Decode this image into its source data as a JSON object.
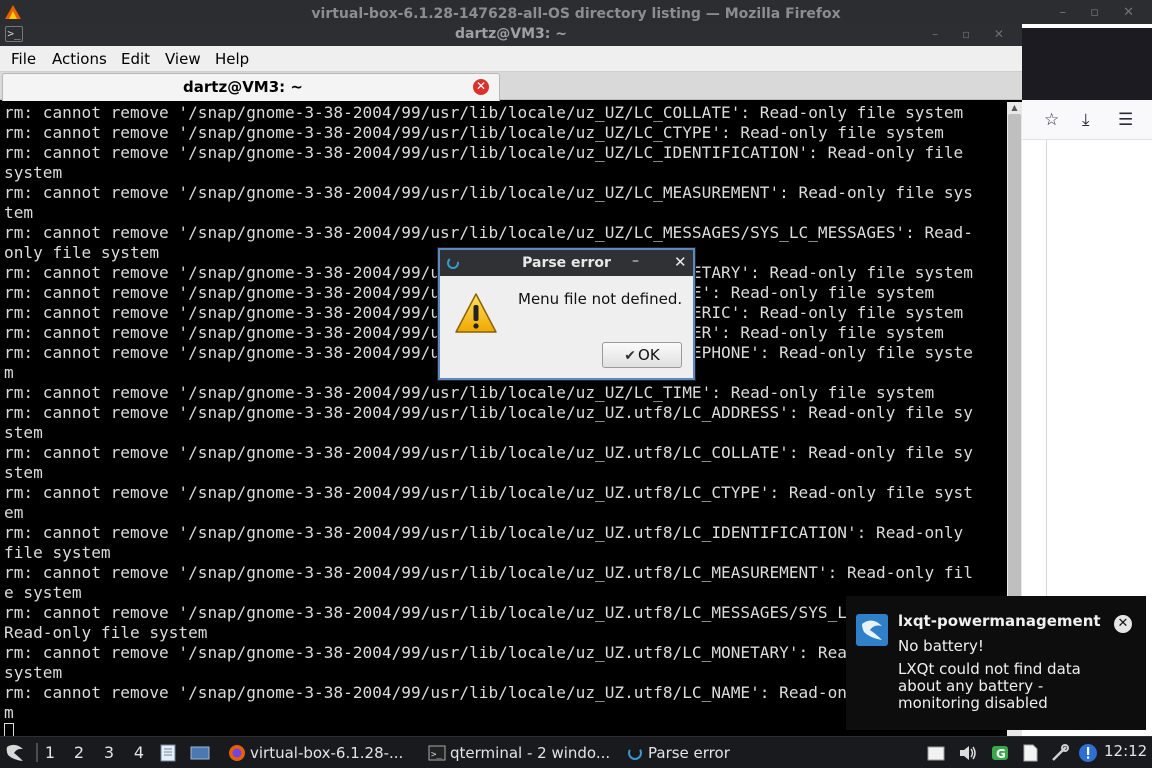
{
  "firefox": {
    "title": "virtual-box-6.1.28-147628-all-OS directory listing — Mozilla Firefox",
    "win_buttons": "– ▫ ✕"
  },
  "terminal": {
    "title": "dartz@VM3: ~",
    "win_buttons": "– ▫ ✕",
    "menu": [
      "File",
      "Actions",
      "Edit",
      "View",
      "Help"
    ],
    "tab_label": "dartz@VM3: ~",
    "lines": [
      "rm: cannot remove '/snap/gnome-3-38-2004/99/usr/lib/locale/uz_UZ/LC_COLLATE': Read-only file system",
      "rm: cannot remove '/snap/gnome-3-38-2004/99/usr/lib/locale/uz_UZ/LC_CTYPE': Read-only file system",
      "rm: cannot remove '/snap/gnome-3-38-2004/99/usr/lib/locale/uz_UZ/LC_IDENTIFICATION': Read-only file",
      "system",
      "rm: cannot remove '/snap/gnome-3-38-2004/99/usr/lib/locale/uz_UZ/LC_MEASUREMENT': Read-only file sys",
      "tem",
      "rm: cannot remove '/snap/gnome-3-38-2004/99/usr/lib/locale/uz_UZ/LC_MESSAGES/SYS_LC_MESSAGES': Read-",
      "only file system",
      "rm: cannot remove '/snap/gnome-3-38-2004/99/usr/lib/locale/uz_UZ/LC_MONETARY': Read-only file system",
      "rm: cannot remove '/snap/gnome-3-38-2004/99/usr/lib/locale/uz_UZ/LC_NAME': Read-only file system",
      "rm: cannot remove '/snap/gnome-3-38-2004/99/usr/lib/locale/uz_UZ/LC_NUMERIC': Read-only file system",
      "rm: cannot remove '/snap/gnome-3-38-2004/99/usr/lib/locale/uz_UZ/LC_PAPER': Read-only file system",
      "rm: cannot remove '/snap/gnome-3-38-2004/99/usr/lib/locale/uz_UZ/LC_TELEPHONE': Read-only file syste",
      "m",
      "rm: cannot remove '/snap/gnome-3-38-2004/99/usr/lib/locale/uz_UZ/LC_TIME': Read-only file system",
      "rm: cannot remove '/snap/gnome-3-38-2004/99/usr/lib/locale/uz_UZ.utf8/LC_ADDRESS': Read-only file sy",
      "stem",
      "rm: cannot remove '/snap/gnome-3-38-2004/99/usr/lib/locale/uz_UZ.utf8/LC_COLLATE': Read-only file sy",
      "stem",
      "rm: cannot remove '/snap/gnome-3-38-2004/99/usr/lib/locale/uz_UZ.utf8/LC_CTYPE': Read-only file syst",
      "em",
      "rm: cannot remove '/snap/gnome-3-38-2004/99/usr/lib/locale/uz_UZ.utf8/LC_IDENTIFICATION': Read-only",
      "file system",
      "rm: cannot remove '/snap/gnome-3-38-2004/99/usr/lib/locale/uz_UZ.utf8/LC_MEASUREMENT': Read-only fil",
      "e system",
      "rm: cannot remove '/snap/gnome-3-38-2004/99/usr/lib/locale/uz_UZ.utf8/LC_MESSAGES/SYS_LC_MESSAGES':",
      "Read-only file system",
      "rm: cannot remove '/snap/gnome-3-38-2004/99/usr/lib/locale/uz_UZ.utf8/LC_MONETARY': Read-only file",
      "system",
      "rm: cannot remove '/snap/gnome-3-38-2004/99/usr/lib/locale/uz_UZ.utf8/LC_NAME': Read-only file syste",
      "m"
    ]
  },
  "dialog": {
    "title": "Parse error",
    "minimize": "–",
    "close": "✕",
    "message": "Menu file not defined.",
    "ok_label": "OK"
  },
  "notification": {
    "app": "lxqt-powermanagement",
    "summary": "No battery!",
    "body": "LXQt could not find data about any battery - monitoring disabled",
    "close": "✕"
  },
  "taskbar": {
    "desktops": [
      "1",
      "2",
      "3",
      "4"
    ],
    "tasks": [
      {
        "label": "virtual-box-6.1.28-...",
        "icon": "firefox-icon"
      },
      {
        "label": "qterminal - 2 windo...",
        "icon": "terminal-icon"
      },
      {
        "label": "Parse error",
        "icon": "dialog-icon"
      }
    ],
    "clock": "12:12"
  },
  "colors": {
    "terminal_bg": "#000000",
    "terminal_fg": "#dcdcdc",
    "dialog_border": "#5a8ac0",
    "notification_icon": "#2f7fc9",
    "tab_close": "#d9322d"
  }
}
